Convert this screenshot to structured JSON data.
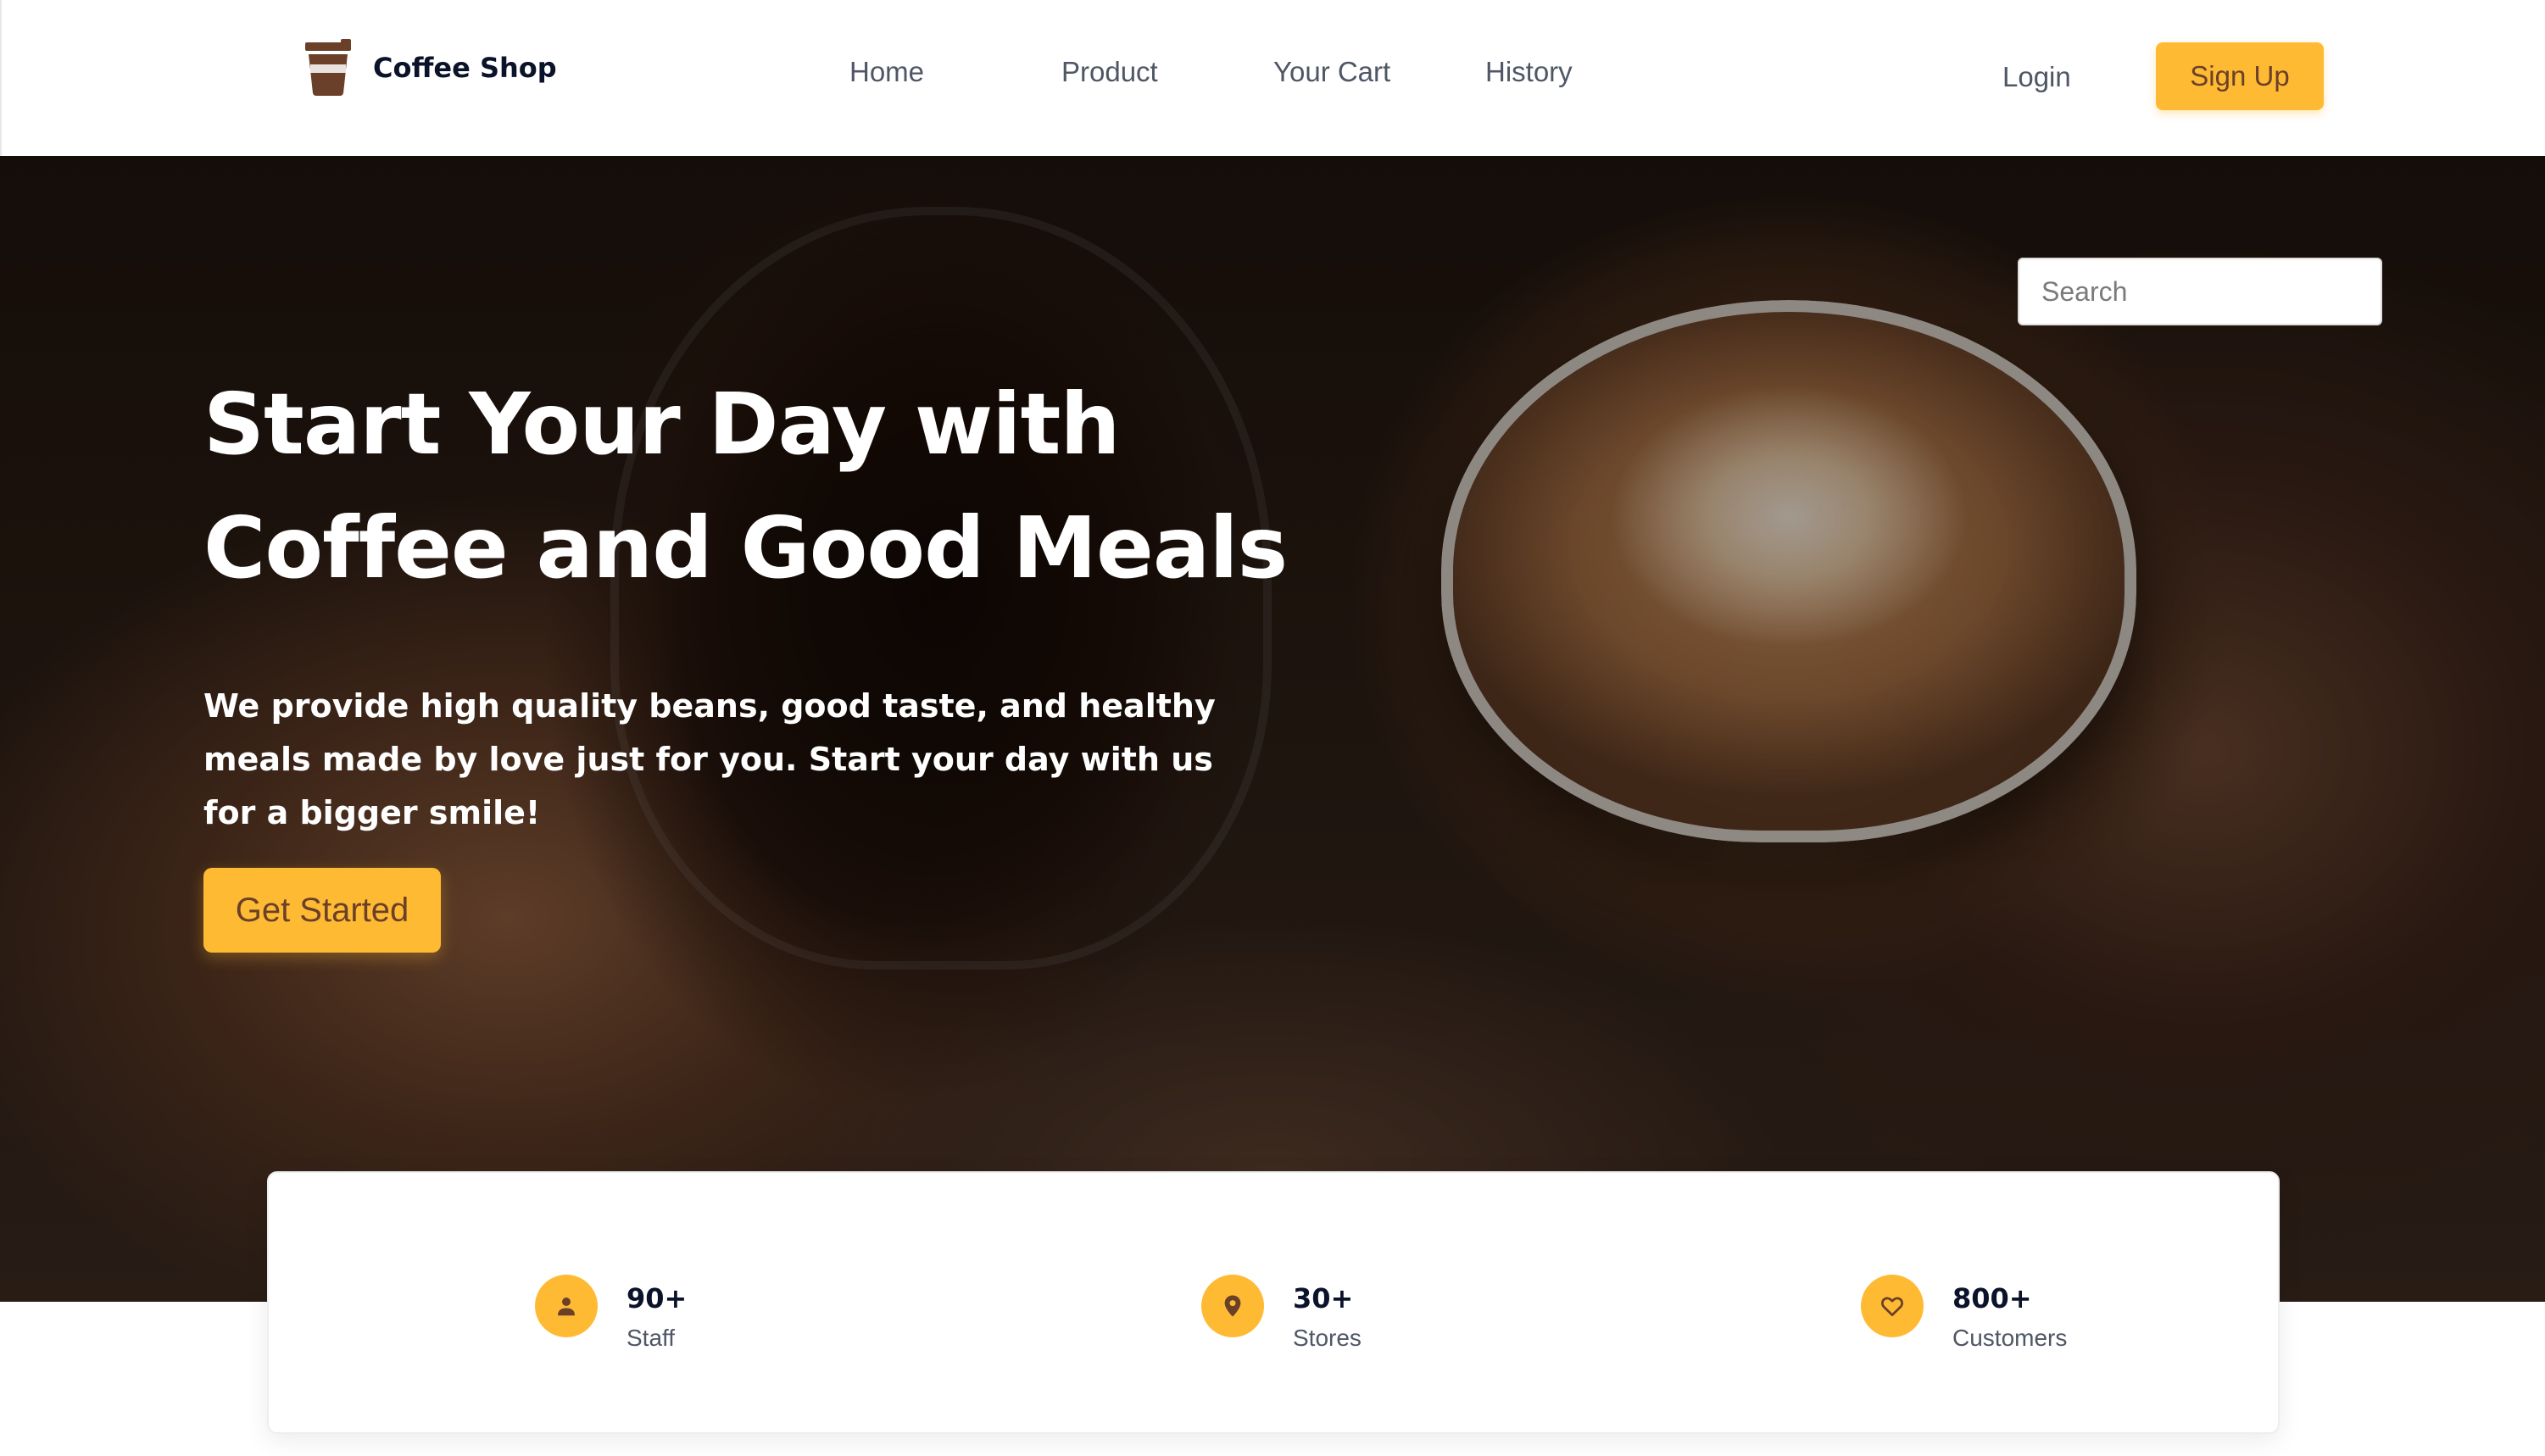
{
  "brand": {
    "name": "Coffee Shop",
    "icon": "coffee-cup-icon"
  },
  "nav": {
    "links": [
      {
        "label": "Home",
        "name": "home"
      },
      {
        "label": "Product",
        "name": "product"
      },
      {
        "label": "Your Cart",
        "name": "your-cart"
      },
      {
        "label": "History",
        "name": "history"
      }
    ],
    "login_label": "Login",
    "signup_label": "Sign Up"
  },
  "hero": {
    "search_placeholder": "Search",
    "title": "Start Your Day with Coffee and Good Meals",
    "subtitle": "We provide high quality beans, good taste, and healthy meals made by love just for you. Start your day with us for a bigger smile!",
    "cta_label": "Get Started"
  },
  "stats": [
    {
      "value": "90+",
      "label": "Staff",
      "icon": "user-icon"
    },
    {
      "value": "30+",
      "label": "Stores",
      "icon": "location-pin-icon"
    },
    {
      "value": "800+",
      "label": "Customers",
      "icon": "heart-icon"
    }
  ],
  "colors": {
    "accent": "#ffba33",
    "accent_text": "#6a4029",
    "dark_text": "#0b132a",
    "muted_text": "#4f5665"
  }
}
